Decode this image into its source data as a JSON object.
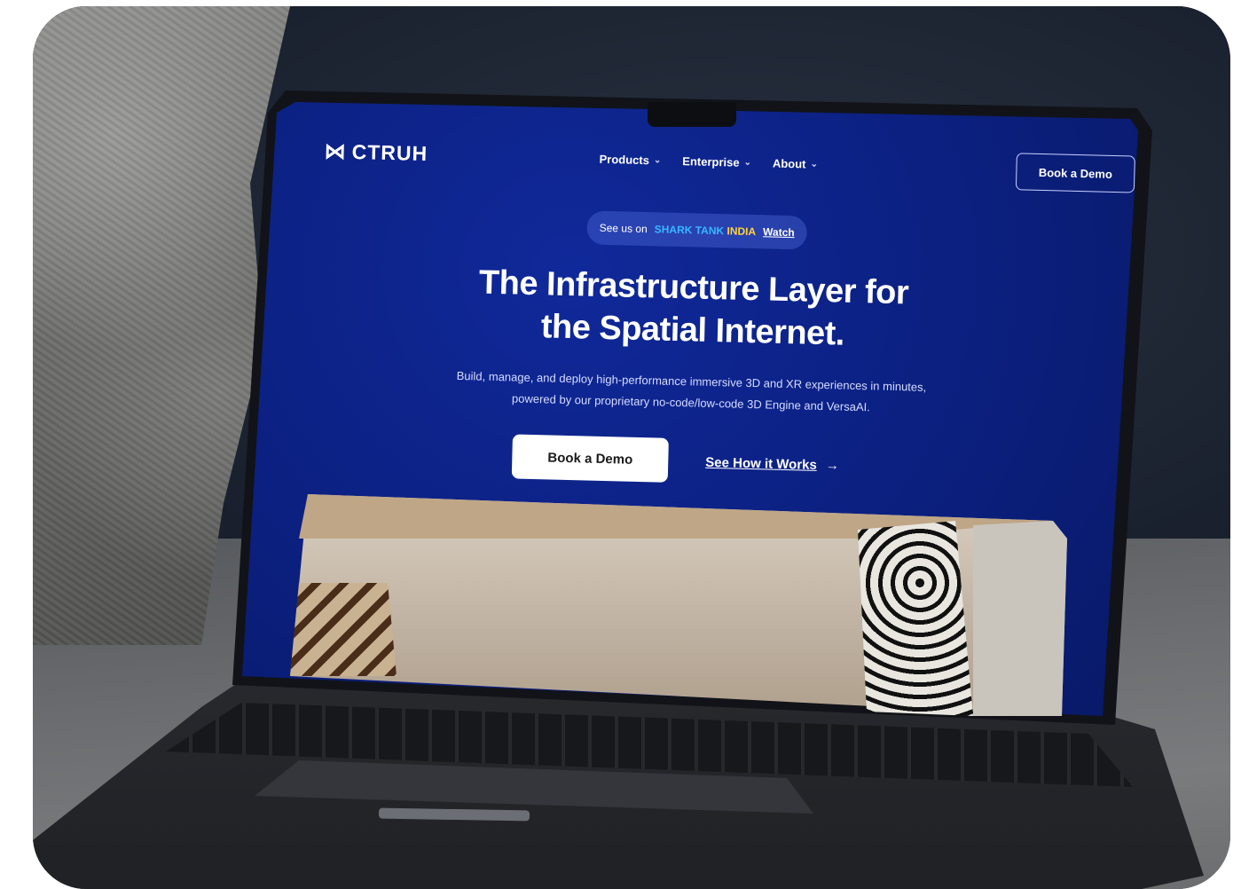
{
  "site": {
    "logo": "CTRUH",
    "nav": [
      "Products",
      "Enterprise",
      "About"
    ],
    "nav_cta": "Book a Demo",
    "banner": {
      "prefix": "See us on",
      "show_name": "SHARK TANK",
      "show_country": "INDIA",
      "link": "Watch"
    },
    "hero": {
      "title_line1": "The Infrastructure Layer for",
      "title_line2": "the Spatial Internet.",
      "subtitle_line1": "Build, manage, and deploy high-performance immersive 3D and XR experiences in minutes,",
      "subtitle_line2": "powered by our proprietary no-code/low-code 3D Engine and VersaAI.",
      "primary_cta": "Book a Demo",
      "secondary_cta": "See How it Works",
      "secondary_arrow": "→"
    }
  },
  "colors": {
    "screen_bg": "#0b1f7e",
    "accent_blue": "#38b7ff",
    "accent_yellow": "#ffd43b"
  },
  "icons": {
    "logo_mark": "ctruh-logo-icon",
    "chevron": "chevron-down-icon",
    "arrow": "arrow-right-icon"
  }
}
